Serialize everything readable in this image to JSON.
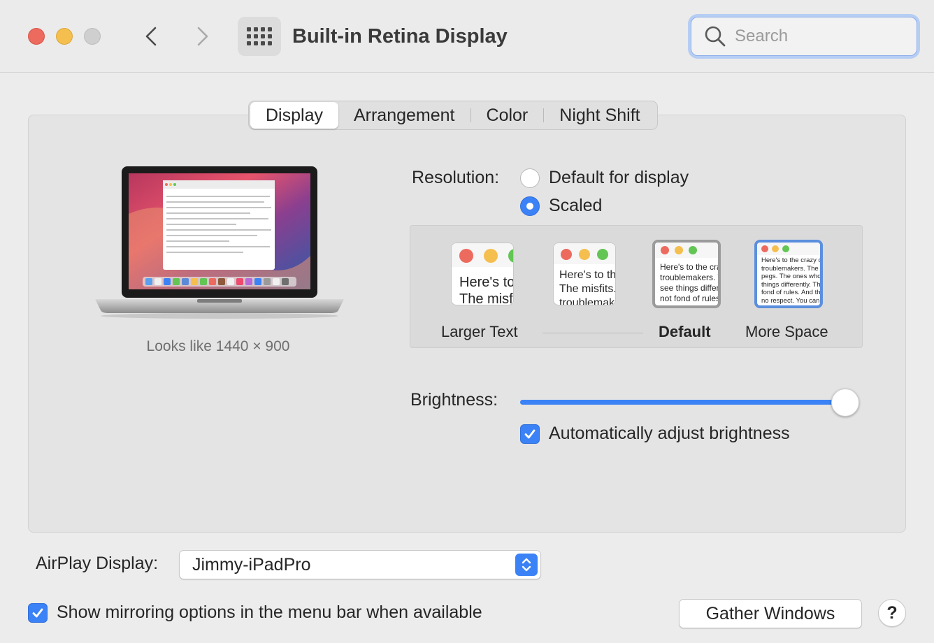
{
  "window": {
    "title": "Built-in Retina Display"
  },
  "search": {
    "placeholder": "Search"
  },
  "tabs": [
    {
      "label": "Display",
      "active": true
    },
    {
      "label": "Arrangement",
      "active": false
    },
    {
      "label": "Color",
      "active": false
    },
    {
      "label": "Night Shift",
      "active": false
    }
  ],
  "preview": {
    "looks_like": "Looks like 1440 × 900"
  },
  "resolution": {
    "label": "Resolution:",
    "options": [
      {
        "label": "Default for display",
        "selected": false
      },
      {
        "label": "Scaled",
        "selected": true
      }
    ],
    "scales": [
      {
        "label": "Larger Text",
        "sample": "Here's to the crazy ones. The misfits. The rebels. The troublemakers. The round pegs in the square holes.",
        "selected": false
      },
      {
        "label": "",
        "sample": "Here's to the crazy ones. The misfits. The rebels. The troublemakers. The ones who see things differently.",
        "selected": false
      },
      {
        "label": "Default",
        "sample": "Here's to the crazy ones. The troublemakers. The ones who see things differently. They're not fond of rules. And they have no respect for the status quo.",
        "selected": true
      },
      {
        "label": "More Space",
        "sample": "Here's to the crazy ones. The troublemakers. The round pegs. The ones who see things differently. They're not fond of rules. And they have no respect. You can quote them, disagree with them. About the only thing you can't do is ignore them. Because they change things.",
        "selected": false
      }
    ]
  },
  "brightness": {
    "label": "Brightness:",
    "level": 0.98,
    "auto_label": "Automatically adjust brightness",
    "auto_checked": true
  },
  "airplay": {
    "label": "AirPlay Display:",
    "value": "Jimmy-iPadPro"
  },
  "mirroring": {
    "label": "Show mirroring options in the menu bar when available",
    "checked": true
  },
  "buttons": {
    "gather": "Gather Windows",
    "help": "?"
  },
  "colors": {
    "accent": "#3b82f6",
    "close": "#ed6a5e",
    "minimize": "#f5bf4f",
    "zoom_inactive": "#cfcfcf"
  }
}
